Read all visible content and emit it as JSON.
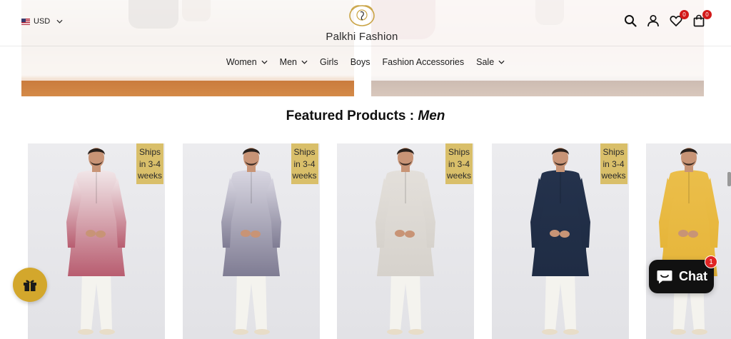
{
  "header": {
    "currency": "USD",
    "logo_text": "Palkhi Fashion",
    "wishlist_count": "0",
    "cart_count": "0",
    "icons": [
      "search-icon",
      "account-icon",
      "heart-icon",
      "bag-icon"
    ]
  },
  "nav": {
    "items": [
      {
        "label": "Women",
        "dropdown": true
      },
      {
        "label": "Men",
        "dropdown": true
      },
      {
        "label": "Girls",
        "dropdown": false
      },
      {
        "label": "Boys",
        "dropdown": false
      },
      {
        "label": "Fashion Accessories",
        "dropdown": false
      },
      {
        "label": "Sale",
        "dropdown": true
      }
    ]
  },
  "section": {
    "title_prefix": "Featured Products :",
    "title_accent": "Men"
  },
  "products": [
    {
      "badge_lines": [
        "Ships",
        "in 3-4",
        "weeks"
      ],
      "kurta_color": "#b85d70",
      "kurta_top": "#f1e6e8"
    },
    {
      "badge_lines": [
        "Ships",
        "in 3-4",
        "weeks"
      ],
      "kurta_color": "#7f7c93",
      "kurta_top": "#d8d6e1"
    },
    {
      "badge_lines": [
        "Ships",
        "in 3-4",
        "weeks"
      ],
      "kurta_color": "#d6d2cc",
      "kurta_top": "#e3dfda"
    },
    {
      "badge_lines": [
        "Ships",
        "in 3-4",
        "weeks"
      ],
      "kurta_color": "#1f2c44",
      "kurta_top": "#24324c"
    },
    {
      "badge_lines": [],
      "kurta_color": "#e6b53a",
      "kurta_top": "#ebbe4a"
    }
  ],
  "widgets": {
    "chat_label": "Chat",
    "chat_badge": "1"
  },
  "colors": {
    "badge_gold": "#d9bf6a",
    "gift_gold": "#d3a72c",
    "alert_red": "#d21a1a"
  }
}
